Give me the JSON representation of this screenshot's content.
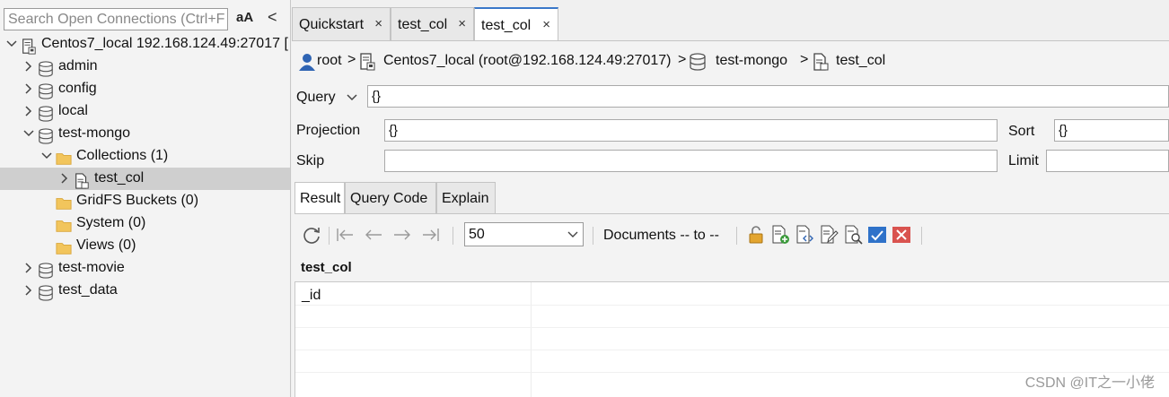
{
  "sidebar": {
    "search_placeholder": "Search Open Connections (Ctrl+F",
    "aa_label": "aA",
    "collapse_label": "<",
    "tree": [
      {
        "label": "Centos7_local 192.168.124.49:27017 [",
        "icon": "server-icon",
        "level": 0,
        "chevron": "down"
      },
      {
        "label": "admin",
        "icon": "database-icon",
        "level": 1,
        "chevron": "right"
      },
      {
        "label": "config",
        "icon": "database-icon",
        "level": 1,
        "chevron": "right"
      },
      {
        "label": "local",
        "icon": "database-icon",
        "level": 1,
        "chevron": "right"
      },
      {
        "label": "test-mongo",
        "icon": "database-icon",
        "level": 1,
        "chevron": "down"
      },
      {
        "label": "Collections (1)",
        "icon": "folder-icon",
        "level": 2,
        "chevron": "down"
      },
      {
        "label": "test_col",
        "icon": "collection-icon",
        "level": 3,
        "chevron": "right",
        "selected": true
      },
      {
        "label": "GridFS Buckets (0)",
        "icon": "folder-icon",
        "level": 2,
        "chevron": "none"
      },
      {
        "label": "System (0)",
        "icon": "folder-icon",
        "level": 2,
        "chevron": "none"
      },
      {
        "label": "Views (0)",
        "icon": "folder-icon",
        "level": 2,
        "chevron": "none"
      },
      {
        "label": "test-movie",
        "icon": "database-icon",
        "level": 1,
        "chevron": "right"
      },
      {
        "label": "test_data",
        "icon": "database-icon",
        "level": 1,
        "chevron": "right"
      }
    ]
  },
  "tabs": [
    {
      "label": "Quickstart",
      "close": "×",
      "active": false
    },
    {
      "label": "test_col",
      "close": "×",
      "active": false
    },
    {
      "label": "test_col",
      "close": "×",
      "active": true
    }
  ],
  "breadcrumb": {
    "user": "root",
    "connection": "Centos7_local (root@192.168.124.49:27017)",
    "database": "test-mongo",
    "collection": "test_col"
  },
  "query": {
    "query_label": "Query",
    "query_value": "{}",
    "projection_label": "Projection",
    "projection_value": "{}",
    "sort_label": "Sort",
    "sort_value": "{}",
    "skip_label": "Skip",
    "skip_value": "",
    "limit_label": "Limit",
    "limit_value": ""
  },
  "result_tabs": [
    "Result",
    "Query Code",
    "Explain"
  ],
  "toolbar": {
    "limit_value": "50",
    "documents_label": "Documents -- to --"
  },
  "results": {
    "collection_title": "test_col",
    "columns": [
      "_id"
    ]
  },
  "watermark": "CSDN @IT之一小佬",
  "colors": {
    "accent": "#3a78c9",
    "folder": "#f2c55c",
    "selected_row": "#cfcfcf",
    "delete_red": "#d9534f"
  }
}
